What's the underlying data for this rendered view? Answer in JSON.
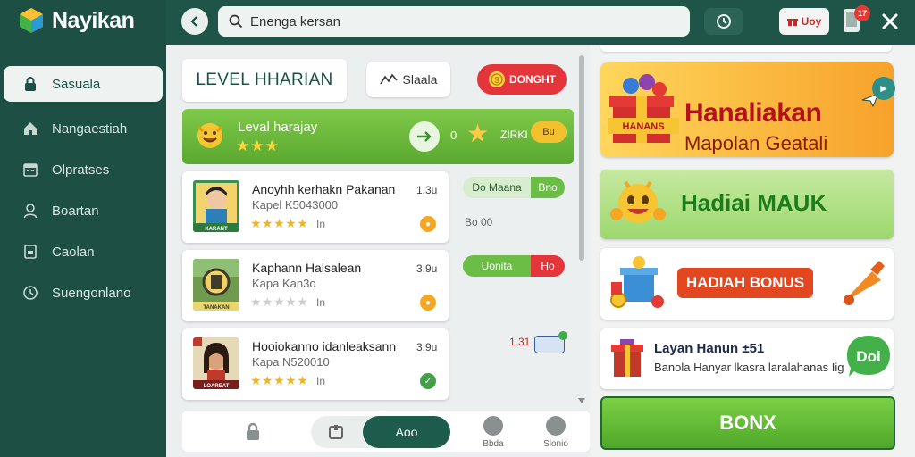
{
  "app": {
    "title": "Nayikan"
  },
  "sidebar": {
    "items": [
      {
        "label": "Sasuala",
        "icon": "lock-icon",
        "active": true
      },
      {
        "label": "Nangaestiah",
        "icon": "home-icon"
      },
      {
        "label": "Olpratses",
        "icon": "calendar-icon"
      },
      {
        "label": "Boartan",
        "icon": "person-icon"
      },
      {
        "label": "Caolan",
        "icon": "file-icon"
      },
      {
        "label": "Suengonlano",
        "icon": "clock-icon"
      }
    ]
  },
  "topbar": {
    "search_value": "Enenga kersan",
    "badge_label": "Uoy",
    "notification_count": "17"
  },
  "middle": {
    "tab_level": "LEVEL HHARIAN",
    "tab_status": "Slaala",
    "tab_point": "DONGHT",
    "banner": {
      "title": "Leval harajay",
      "stars": "★★★",
      "count": "0",
      "points": "ZIRKI",
      "pill": "Bu"
    },
    "cards": [
      {
        "title": "Anoyhh kerhakn Pakanan",
        "sub": "Kapel K5043000",
        "rating": "1.3u",
        "stars_on": 5,
        "stars_total": 5,
        "in": "In",
        "thumb_caption": "KARANT"
      },
      {
        "title": "Kaphann Halsalean",
        "sub": "Kapa Kan3o",
        "rating": "3.9u",
        "stars_on": 0,
        "stars_total": 5,
        "in": "In",
        "thumb_caption": "TANAKAN"
      },
      {
        "title": "Hooiokanno idanleaksann",
        "sub": "Kapa N520010",
        "rating": "3.9u",
        "stars_on": 5,
        "stars_total": 5,
        "in": "In",
        "thumb_caption": "LOAREAT"
      }
    ],
    "side_pills": [
      {
        "left": "Do Maana",
        "right": "Bno"
      },
      {
        "left": "Uonita",
        "right": "Ho"
      }
    ],
    "side_values": [
      "Bo 00",
      "1.31"
    ],
    "bottom_bar": {
      "toggle_label": "Aoo",
      "items": [
        "Bbda",
        "Slonio"
      ]
    }
  },
  "right": {
    "promo1": {
      "title": "Hanaliakan",
      "subtitle": "Mapolan Geatali",
      "gift_label": "HANANS"
    },
    "promo2": {
      "title": "Hadiai MAUK"
    },
    "promo3": {
      "label": "HADIAH BONUS"
    },
    "promo4": {
      "title": "Layan Hanun ±51",
      "subtitle": "Banola Hanyar lkasra laralahanas Iig",
      "badge": "Doi"
    },
    "button": "BONX"
  }
}
